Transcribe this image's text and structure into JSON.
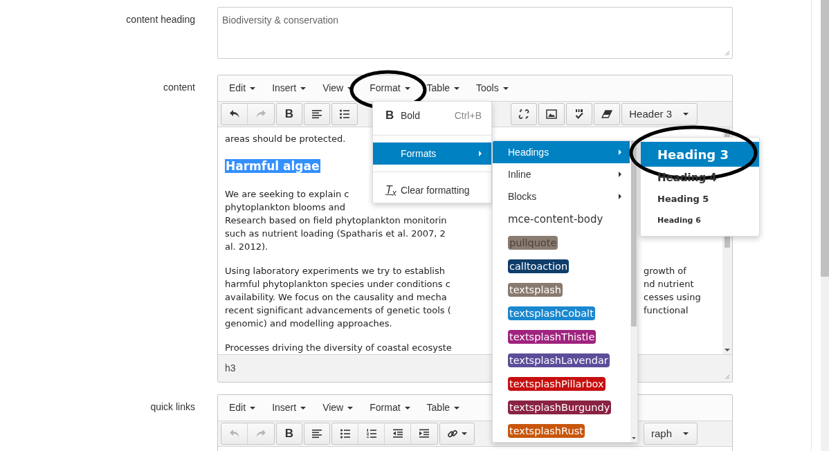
{
  "fields": [
    {
      "label": "content heading",
      "kind": "textarea",
      "value": "Biodiversity & conservation"
    },
    {
      "label": "content",
      "kind": "editor",
      "menubar": [
        {
          "label": "Edit",
          "circled": false
        },
        {
          "label": "Insert",
          "circled": false
        },
        {
          "label": "View",
          "circled": false
        },
        {
          "label": "Format",
          "circled": true
        },
        {
          "label": "Table",
          "circled": false
        },
        {
          "label": "Tools",
          "circled": false
        }
      ],
      "toolbar_left": [
        [
          {
            "kind": "undo",
            "disabled": false
          },
          {
            "kind": "redo",
            "disabled": true
          }
        ],
        [
          {
            "kind": "text",
            "label": "B",
            "disabled": false
          }
        ],
        [
          {
            "kind": "align",
            "disabled": false
          }
        ],
        [
          {
            "kind": "bullets",
            "disabled": false
          }
        ]
      ],
      "toolbar_right": [
        [
          {
            "kind": "unlink",
            "disabled": false
          }
        ],
        [
          {
            "kind": "image",
            "disabled": false
          }
        ],
        [
          {
            "kind": "spellcheck",
            "disabled": false
          }
        ],
        [
          {
            "kind": "eraser",
            "disabled": false
          }
        ],
        [
          {
            "kind": "select",
            "label": "Header 3"
          }
        ]
      ],
      "body": [
        {
          "kind": "p",
          "lines": [
            {
              "left": "areas should be protected."
            }
          ]
        },
        {
          "kind": "h3",
          "text": "Harmful algae",
          "selected": true
        },
        {
          "kind": "p",
          "lines": [
            {
              "left": "We are seeking to explain c"
            },
            {
              "left": "phytoplankton blooms and"
            },
            {
              "left": "Research based on field phytoplankton monitorin"
            },
            {
              "left": "such as nutrient loading (Spatharis et al. 2007, 2"
            },
            {
              "left": "al. 2012)."
            }
          ]
        },
        {
          "kind": "p",
          "lines": [
            {
              "left": "Using laboratory experiments we try to establish",
              "right": "growth of"
            },
            {
              "left": "harmful phytoplankton species under conditions c",
              "right": "nd nutrient"
            },
            {
              "left": "availability. We focus on the causality and mecha",
              "right": "cesses using"
            },
            {
              "left": "recent significant advancements of genetic tools (",
              "right": "functional"
            },
            {
              "left": "genomic) and modelling approaches."
            }
          ]
        },
        {
          "kind": "p",
          "lines": [
            {
              "left": "Processes driving the diversity of coastal ecosyste"
            }
          ]
        }
      ],
      "status": "h3"
    },
    {
      "label": "quick links",
      "kind": "editor",
      "menubar": [
        {
          "label": "Edit",
          "circled": false
        },
        {
          "label": "Insert",
          "circled": false
        },
        {
          "label": "View",
          "circled": false
        },
        {
          "label": "Format",
          "circled": false
        },
        {
          "label": "Table",
          "circled": false
        }
      ],
      "toolbar_left": [
        [
          {
            "kind": "undo",
            "disabled": true
          },
          {
            "kind": "redo",
            "disabled": true
          }
        ],
        [
          {
            "kind": "text",
            "label": "B",
            "disabled": false
          }
        ],
        [
          {
            "kind": "align",
            "disabled": false
          }
        ],
        [
          {
            "kind": "bullets",
            "disabled": false
          },
          {
            "kind": "numbers",
            "disabled": false
          },
          {
            "kind": "outdent",
            "disabled": false
          },
          {
            "kind": "indent",
            "disabled": false
          }
        ],
        [
          {
            "kind": "link",
            "disabled": false
          }
        ]
      ],
      "toolbar_right": [
        [
          {
            "kind": "select",
            "label": "raph"
          }
        ]
      ]
    }
  ],
  "format_menu": {
    "items": [
      {
        "kind": "command",
        "glyph": "B",
        "label": "Bold",
        "shortcut": "Ctrl+B",
        "selected": false
      },
      {
        "kind": "submenu",
        "label": "Formats",
        "selected": true
      },
      {
        "kind": "command",
        "glyph": "T$_{x}$",
        "label": "Clear formatting",
        "selected": false
      }
    ]
  },
  "formats_menu": {
    "items": [
      {
        "kind": "submenu",
        "label": "Headings",
        "selected": true
      },
      {
        "kind": "submenu",
        "label": "Inline",
        "selected": false
      },
      {
        "kind": "submenu",
        "label": "Blocks",
        "selected": false
      },
      {
        "kind": "plain",
        "label": "mce-content-body",
        "selected": false
      },
      {
        "kind": "badge-dark",
        "label": "pullquote",
        "color": "#8a7c71",
        "selected": false
      },
      {
        "kind": "badge",
        "label": "calltoaction",
        "color": "#0f3d6a",
        "selected": false
      },
      {
        "kind": "badge",
        "label": "textsplash",
        "color": "#887a6f",
        "selected": false
      },
      {
        "kind": "badge",
        "label": "textsplashCobalt",
        "color": "#1a88d0",
        "selected": false
      },
      {
        "kind": "badge",
        "label": "textsplashThistle",
        "color": "#a0237f",
        "selected": false
      },
      {
        "kind": "badge",
        "label": "textsplashLavendar",
        "color": "#5d4c99",
        "selected": false
      },
      {
        "kind": "badge",
        "label": "textsplashPillarbox",
        "color": "#c70f0f",
        "selected": false
      },
      {
        "kind": "badge",
        "label": "textsplashBurgundy",
        "color": "#8a2341",
        "selected": false
      },
      {
        "kind": "badge",
        "label": "textsplashRust",
        "color": "#c8560c",
        "selected": false
      }
    ]
  },
  "headings_menu": {
    "items": [
      {
        "kind": "h3",
        "label": "Heading 3",
        "selected": true,
        "circled": true
      },
      {
        "kind": "h4",
        "label": "Heading 4",
        "selected": false,
        "circled": false
      },
      {
        "kind": "h5",
        "label": "Heading 5",
        "selected": false,
        "circled": false
      },
      {
        "kind": "h6",
        "label": "Heading 6",
        "selected": false,
        "circled": false
      }
    ]
  }
}
